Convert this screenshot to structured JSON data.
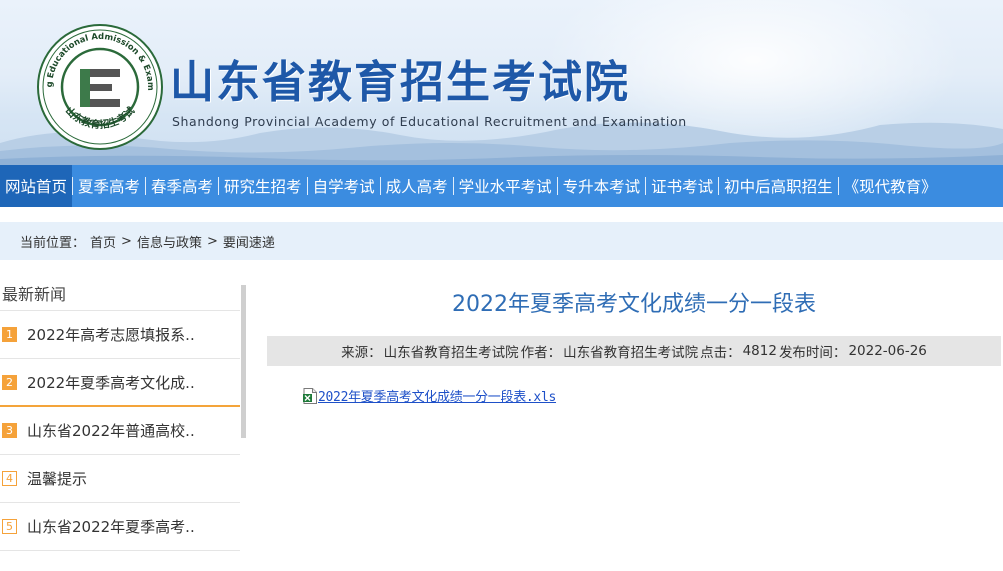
{
  "header": {
    "title": "山东省教育招生考试院",
    "subtitle": "Shandong Provincial Academy of Educational Recruitment and Examination",
    "logo": {
      "ring_text_top": "Shandong Educational Admission & Examinations",
      "ring_text_bottom": "山东教育招生考试",
      "center_letter": "E"
    },
    "colors": {
      "title": "#1e58a8",
      "nav": "#3b8ce0",
      "nav_active": "#1e66b8",
      "accent": "#f5a23a"
    }
  },
  "nav": {
    "items": [
      {
        "label": "网站首页",
        "active": true
      },
      {
        "label": "夏季高考",
        "active": false
      },
      {
        "label": "春季高考",
        "active": false
      },
      {
        "label": "研究生招考",
        "active": false
      },
      {
        "label": "自学考试",
        "active": false
      },
      {
        "label": "成人高考",
        "active": false
      },
      {
        "label": "学业水平考试",
        "active": false
      },
      {
        "label": "专升本考试",
        "active": false
      },
      {
        "label": "证书考试",
        "active": false
      },
      {
        "label": "初中后高职招生",
        "active": false
      },
      {
        "label": "《现代教育》",
        "active": false
      }
    ]
  },
  "breadcrumb": {
    "prefix": "当前位置：",
    "items": [
      "首页",
      "信息与政策",
      "要闻速递"
    ],
    "separator": ">"
  },
  "sidebar": {
    "title": "最新新闻",
    "items": [
      {
        "num": "1",
        "text": "2022年高考志愿填报系..",
        "style": "filled"
      },
      {
        "num": "2",
        "text": "2022年夏季高考文化成..",
        "style": "filled"
      },
      {
        "num": "3",
        "text": "山东省2022年普通高校..",
        "style": "filled"
      },
      {
        "num": "4",
        "text": "温馨提示",
        "style": "outline"
      },
      {
        "num": "5",
        "text": "山东省2022年夏季高考..",
        "style": "outline"
      }
    ]
  },
  "article": {
    "title": "2022年夏季高考文化成绩一分一段表",
    "meta": {
      "source_label": "来源：",
      "source": "山东省教育招生考试院",
      "author_label": "作者：",
      "author": "山东省教育招生考试院",
      "clicks_label": "点击：",
      "clicks": "4812",
      "date_label": "发布时间：",
      "date": "2022-06-26"
    },
    "attachment": {
      "filename": "2022年夏季高考文化成绩一分一段表.xls",
      "icon": "excel-file-icon"
    }
  }
}
